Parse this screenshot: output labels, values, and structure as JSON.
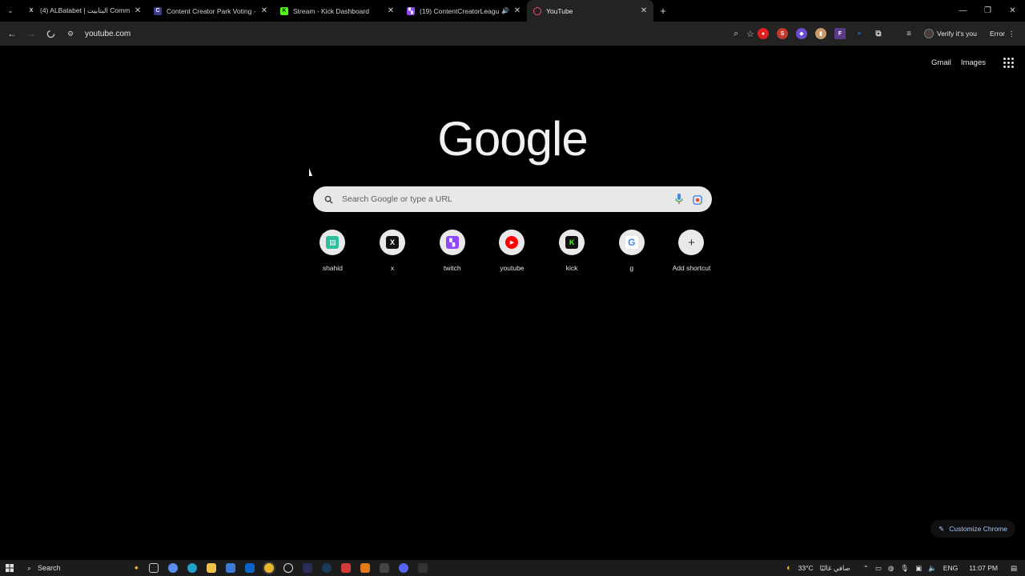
{
  "tabs": [
    {
      "title": "(4) ALBatabet | البتابيت Commun",
      "favicon": "x-icon",
      "color": "#000000",
      "active": false
    },
    {
      "title": "Content Creator Park Voting - V",
      "favicon": "ccp-icon",
      "color": "#3b3b8f",
      "active": false
    },
    {
      "title": "Stream - Kick Dashboard",
      "favicon": "kick-icon",
      "color": "#53fc18",
      "active": false
    },
    {
      "title": "(19) ContentCreatorLeague",
      "favicon": "twitch-icon",
      "color": "#9146ff",
      "active": false,
      "audio": true
    },
    {
      "title": "YouTube",
      "favicon": "loading-icon",
      "color": "#ff4d6d",
      "active": true
    }
  ],
  "toolbar": {
    "url": "youtube.com",
    "profile_label": "Verify it's you",
    "error_label": "Error"
  },
  "extensions": [
    {
      "name": "red-extension-icon",
      "color": "#e02020",
      "glyph": "●"
    },
    {
      "name": "s-extension-icon",
      "color": "#c0392b",
      "glyph": "S"
    },
    {
      "name": "shield-extension-icon",
      "color": "#6a4ccf",
      "glyph": "◆"
    },
    {
      "name": "bottle-extension-icon",
      "color": "#c89a6a",
      "glyph": "▮"
    },
    {
      "name": "f-extension-icon",
      "color": "#5b3a8a",
      "glyph": "F"
    },
    {
      "name": "wave-extension-icon",
      "color": "#3a86ff",
      "glyph": "≈"
    },
    {
      "name": "puzzle-extension-icon",
      "color": "#2a2a2a",
      "glyph": "⧉"
    },
    {
      "name": "media-extension-icon",
      "color": "#2a2a2a",
      "glyph": "≡"
    }
  ],
  "ntp": {
    "gmail_label": "Gmail",
    "images_label": "Images",
    "logo_text": "Google",
    "search_placeholder": "Search Google or type a URL",
    "customize_label": "Customize Chrome",
    "shortcuts": [
      {
        "label": "shahid",
        "icon": "shahid-icon",
        "color": "#2bbf9f",
        "glyph": "▤"
      },
      {
        "label": "x",
        "icon": "x-logo-icon",
        "color": "#111111",
        "glyph": "X"
      },
      {
        "label": "twitch",
        "icon": "twitch-icon",
        "color": "#9146ff",
        "glyph": "▚"
      },
      {
        "label": "youtube",
        "icon": "youtube-icon",
        "color": "#ff0000",
        "glyph": "▶"
      },
      {
        "label": "kick",
        "icon": "kick-icon",
        "color": "#111111",
        "glyph": "K"
      },
      {
        "label": "g",
        "icon": "google-g-icon",
        "color": "#ffffff",
        "glyph": "G"
      },
      {
        "label": "Add shortcut",
        "icon": "plus-icon",
        "color": "#e9e9e9",
        "glyph": "+"
      }
    ]
  },
  "taskbar": {
    "search_label": "Search",
    "weather": "33°C",
    "weather_desc": "صافي غالبًا",
    "lang": "ENG",
    "time": "11:07 PM"
  }
}
